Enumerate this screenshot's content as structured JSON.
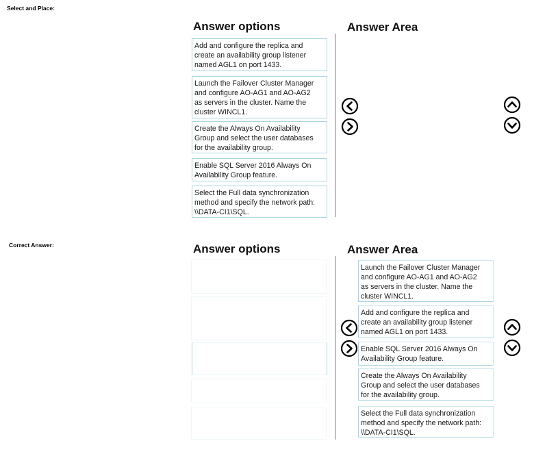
{
  "sections": [
    {
      "label": "Select and Place:",
      "options_heading": "Answer options",
      "area_heading": "Answer Area",
      "options": [
        "Add and configure the replica and\ncreate an availability group listener\nnamed AGL1 on port 1433.",
        "Launch the Failover Cluster Manager\nand configure AO-AG1 and AO-AG2\nas servers in the cluster. Name the\ncluster WINCL1.",
        "Create the Always On Availability\nGroup and select the user databases\nfor the availability group.",
        "Enable SQL Server 2016 Always On\nAvailability Group feature.",
        "Select the Full data synchronization\nmethod and specify the network path:\n\\\\DATA-CI1\\SQL."
      ],
      "answer_area": []
    },
    {
      "label": "Correct Answer:",
      "options_heading": "Answer options",
      "area_heading": "Answer Area",
      "options": [
        "",
        "",
        "",
        "",
        ""
      ],
      "answer_area": [
        "Launch the Failover Cluster Manager\nand configure AO-AG1 and AO-AG2\nas servers in the cluster. Name the\ncluster WINCL1.",
        "Add and configure the replica and\ncreate an availability group listener\nnamed AGL1 on port 1433.",
        "Enable SQL Server 2016 Always On\nAvailability Group feature.",
        "Create the Always On Availability\nGroup and select the user databases\nfor the availability group.",
        "Select the Full data synchronization\nmethod and specify the network path:\n\\\\DATA-CI1\\SQL."
      ]
    }
  ],
  "icons": {
    "move_left": "chevron-left-circle",
    "move_right": "chevron-right-circle",
    "move_up": "chevron-up-circle",
    "move_down": "chevron-down-circle"
  }
}
